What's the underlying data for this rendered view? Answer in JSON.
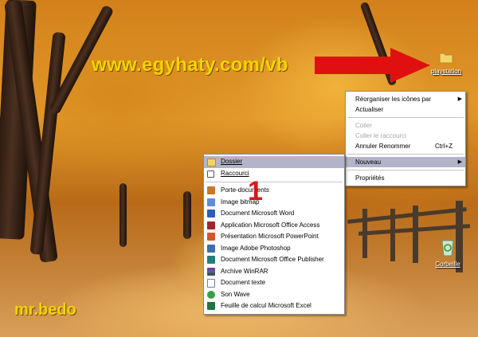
{
  "watermark": "www.egyhaty.com/vb",
  "signature": "mr.bedo",
  "step_number": "1",
  "desktop_icons": [
    {
      "label": "playstation",
      "icon": "folder-icon"
    },
    {
      "label": "Corbeille",
      "icon": "recycle-bin-icon"
    }
  ],
  "context_menu": {
    "items": [
      {
        "label": "Réorganiser les icônes par",
        "disabled": false,
        "submenu": true
      },
      {
        "label": "Actualiser",
        "disabled": false
      },
      {
        "label": "Coller",
        "disabled": true
      },
      {
        "label": "Coller le raccourci",
        "disabled": true
      },
      {
        "label": "Annuler Renommer",
        "shortcut": "Ctrl+Z",
        "disabled": false
      },
      {
        "label": "Nouveau",
        "disabled": false,
        "submenu": true,
        "highlighted": true
      },
      {
        "label": "Propriétés",
        "disabled": false
      }
    ]
  },
  "new_submenu": {
    "items": [
      {
        "label": "Dossier",
        "icon": "folder-icon",
        "highlighted": true
      },
      {
        "label": "Raccourci",
        "icon": "shortcut-icon"
      },
      {
        "label": "Porte-documents",
        "icon": "briefcase-icon"
      },
      {
        "label": "Image bitmap",
        "icon": "bitmap-icon"
      },
      {
        "label": "Document Microsoft Word",
        "icon": "word-icon"
      },
      {
        "label": "Application Microsoft Office Access",
        "icon": "access-icon"
      },
      {
        "label": "Présentation Microsoft PowerPoint",
        "icon": "powerpoint-icon"
      },
      {
        "label": "Image Adobe Photoshop",
        "icon": "photoshop-icon"
      },
      {
        "label": "Document Microsoft Office Publisher",
        "icon": "publisher-icon"
      },
      {
        "label": "Archive WinRAR",
        "icon": "winrar-icon"
      },
      {
        "label": "Document texte",
        "icon": "text-document-icon"
      },
      {
        "label": "Son Wave",
        "icon": "wave-sound-icon"
      },
      {
        "label": "Feuille de calcul Microsoft Excel",
        "icon": "excel-icon"
      }
    ]
  },
  "colors": {
    "menu_highlight": "#b3b4c9",
    "watermark_yellow": "#f2d400",
    "arrow_red": "#e01010",
    "step_red": "#d81818"
  }
}
